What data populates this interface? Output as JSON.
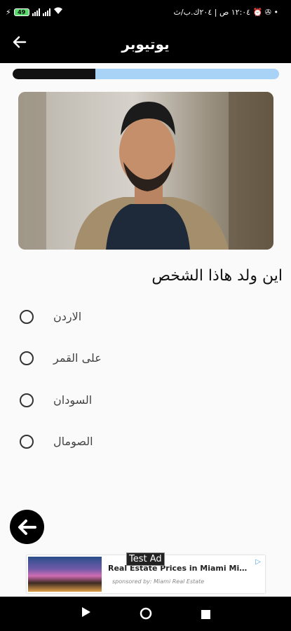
{
  "status_bar": {
    "left_icons": [
      "flash-icon",
      "battery-icon",
      "signal-icon",
      "signal-icon",
      "wifi-icon"
    ],
    "battery_level": "49",
    "right_text": "١٢:٠٤ ص | ٢٠٤ك.ب/ث ⏰ ✇ •"
  },
  "app_bar": {
    "title": "يوتيوبر",
    "back_icon": "arrow-left-icon"
  },
  "quiz": {
    "progress": 0.31,
    "question": "اين ولد هاذا الشخص",
    "options": [
      "الاردن",
      "على القمر",
      "السودان",
      "الصومال"
    ]
  },
  "ad": {
    "headline": "Real Estate Prices in Miami Might...",
    "sponsor": "sponsored by: Miami Real Estate",
    "badge": "Test Ad"
  },
  "nav_bar": {
    "icons": [
      "play-icon",
      "home-circle-icon",
      "square-icon"
    ]
  },
  "colors": {
    "bar_bg": "#000000",
    "progress_track": "#a8d2f6",
    "progress_fill": "#111111"
  }
}
